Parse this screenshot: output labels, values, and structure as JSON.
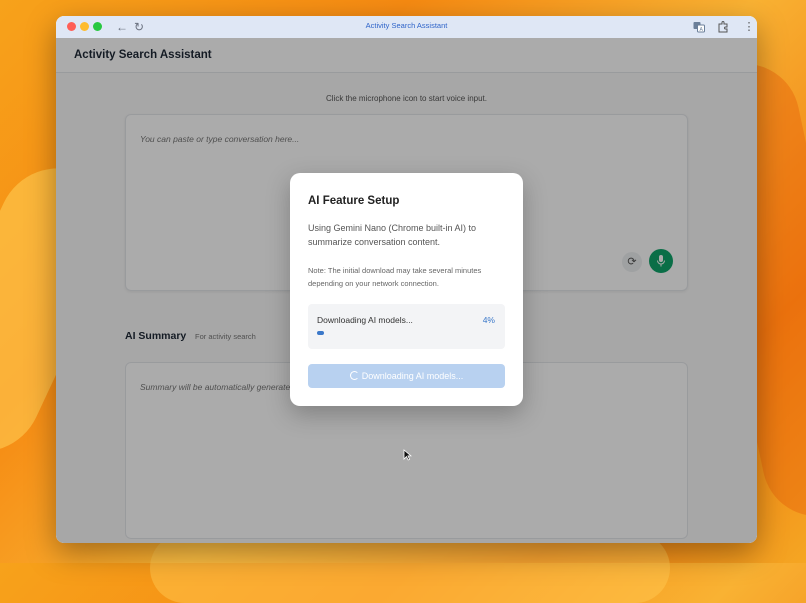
{
  "window": {
    "title": "Activity Search Assistant"
  },
  "app": {
    "title": "Activity Search Assistant",
    "voice_hint": "Click the microphone icon to start voice input.",
    "conversation_placeholder": "You can paste or type conversation here...",
    "summary_label": "AI Summary",
    "summary_sublabel": "For activity search",
    "summary_placeholder": "Summary will be automatically generated..."
  },
  "modal": {
    "title": "AI Feature Setup",
    "description": "Using Gemini Nano (Chrome built-in AI) to summarize conversation content.",
    "note": "Note: The initial download may take several minutes depending on your network connection.",
    "progress_label": "Downloading AI models...",
    "progress_percent_text": "4%",
    "progress_value": 0.04,
    "button_label": "Downloading AI models..."
  },
  "icons": [
    "back-arrow-icon",
    "reload-icon",
    "translate-icon",
    "extension-icon",
    "more-icon",
    "refresh-icon",
    "microphone-icon",
    "spinner-icon",
    "cursor-icon"
  ],
  "colors": {
    "accent": "#3b78c9",
    "mic_button": "#10a46a",
    "button_disabled": "#b8d1f0"
  }
}
